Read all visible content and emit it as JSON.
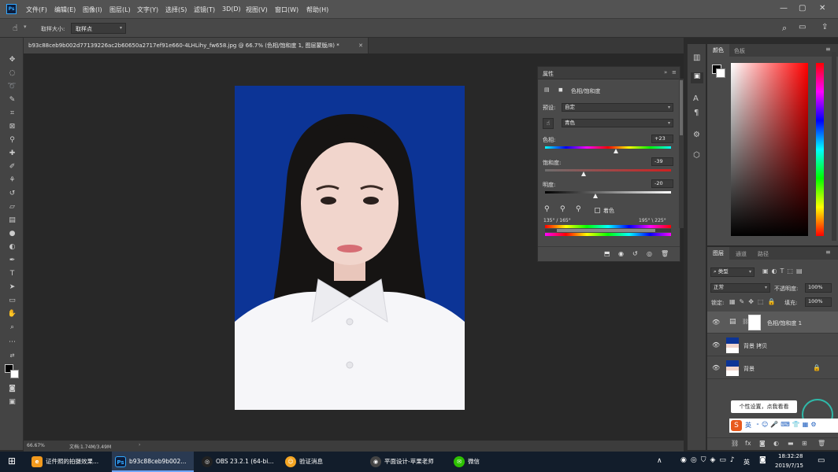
{
  "app": {
    "logo": "Ps"
  },
  "menu": [
    "文件(F)",
    "编辑(E)",
    "图像(I)",
    "图层(L)",
    "文字(Y)",
    "选择(S)",
    "滤镜(T)",
    "3D(D)",
    "视图(V)",
    "窗口(W)",
    "帮助(H)"
  ],
  "options": {
    "sample_size_label": "取样大小:",
    "sample_size_value": "取样点"
  },
  "document": {
    "tab_title": "b93c88ceb9b002d77139226ac2b60650a2717ef91e660-4LHLihy_fw658.jpg @ 66.7% (色相/饱和度 1, 图层蒙版/8) *",
    "zoom": "66.67%",
    "doc_info": "文档:1.74M/3.49M"
  },
  "properties": {
    "tab": "属性",
    "title": "色相/饱和度",
    "preset_label": "预设:",
    "preset_value": "自定",
    "channel_value": "青色",
    "hue_label": "色相:",
    "hue_value": "+23",
    "hue": 23,
    "saturation_label": "饱和度:",
    "saturation_value": "-39",
    "saturation": -39,
    "lightness_label": "明度:",
    "lightness_value": "-20",
    "lightness": -20,
    "colorize_label": "着色",
    "range_left": "135° / 165°",
    "range_right": "195° \\ 225°"
  },
  "color_panel": {
    "tabs": [
      "颜色",
      "色板"
    ]
  },
  "layers_panel": {
    "tabs": [
      "图层",
      "通道",
      "路径"
    ],
    "filter_value": "类型",
    "blend_mode": "正常",
    "opacity_label": "不透明度:",
    "opacity_value": "100%",
    "lock_label": "锁定:",
    "fill_label": "填充:",
    "fill_value": "100%",
    "layers": [
      {
        "name": "色相/饱和度 1",
        "kind": "adjustment"
      },
      {
        "name": "背景 拷贝",
        "kind": "photo"
      },
      {
        "name": "背景",
        "kind": "photo-locked"
      }
    ]
  },
  "tooltip": {
    "text": "个性设置，点我看看"
  },
  "ime": {
    "lang": "英"
  },
  "taskbar": {
    "items": [
      "证件照的拍摄效果...",
      "b93c88ceb9b002...",
      "OBS 23.2.1 (64-bi...",
      "验证消息",
      "平面设计-苹果老师",
      "微信"
    ],
    "tray_lang": "英",
    "time": "18:32:28",
    "date": "2019/7/15"
  }
}
